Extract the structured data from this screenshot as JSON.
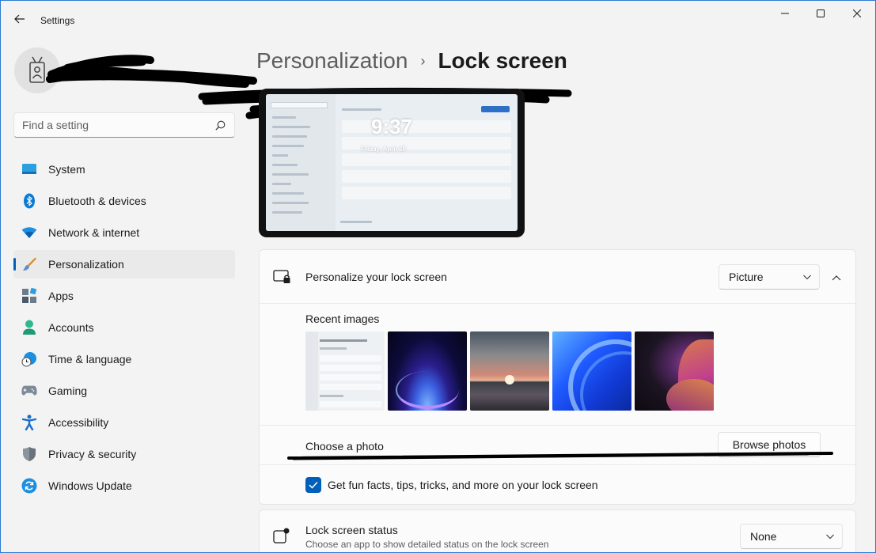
{
  "window": {
    "app_title": "Settings",
    "back_icon": "arrow-left-icon",
    "minimize_icon": "minimize-icon",
    "maximize_icon": "maximize-icon",
    "close_icon": "close-icon"
  },
  "profile": {
    "avatar_icon": "id-badge-icon"
  },
  "search": {
    "placeholder": "Find a setting",
    "value": "",
    "icon": "search-icon"
  },
  "sidebar": {
    "items": [
      {
        "label": "System",
        "icon": "system-icon",
        "active": false
      },
      {
        "label": "Bluetooth & devices",
        "icon": "bluetooth-icon",
        "active": false
      },
      {
        "label": "Network & internet",
        "icon": "wifi-icon",
        "active": false
      },
      {
        "label": "Personalization",
        "icon": "paintbrush-icon",
        "active": true
      },
      {
        "label": "Apps",
        "icon": "apps-icon",
        "active": false
      },
      {
        "label": "Accounts",
        "icon": "person-icon",
        "active": false
      },
      {
        "label": "Time & language",
        "icon": "globe-clock-icon",
        "active": false
      },
      {
        "label": "Gaming",
        "icon": "gamepad-icon",
        "active": false
      },
      {
        "label": "Accessibility",
        "icon": "accessibility-icon",
        "active": false
      },
      {
        "label": "Privacy & security",
        "icon": "shield-icon",
        "active": false
      },
      {
        "label": "Windows Update",
        "icon": "refresh-icon",
        "active": false
      }
    ]
  },
  "header": {
    "parent": "Personalization",
    "separator": "›",
    "current": "Lock screen"
  },
  "preview": {
    "time": "9:37",
    "date": "Friday, April 28"
  },
  "lock_screen_card": {
    "title": "Personalize your lock screen",
    "icon": "lock-screen-icon",
    "dropdown_value": "Picture",
    "expand_icon": "chevron-up-icon",
    "recent_images_label": "Recent images",
    "recent_images": [
      {
        "name": "Bluetooth & devices screenshot",
        "thumb": "screenshot-thumbnail"
      },
      {
        "name": "Windows bloom blue",
        "thumb": "bloom-blue-thumbnail"
      },
      {
        "name": "Sunset lake",
        "thumb": "sunset-thumbnail"
      },
      {
        "name": "Windows bloom light",
        "thumb": "bloom-light-thumbnail"
      },
      {
        "name": "Dark ribbon",
        "thumb": "ribbon-thumbnail"
      }
    ],
    "choose_photo_label": "Choose a photo",
    "browse_button": "Browse photos",
    "fun_facts_label": "Get fun facts, tips, tricks, and more on your lock screen",
    "fun_facts_checked": true
  },
  "status_card": {
    "title": "Lock screen status",
    "subtitle": "Choose an app to show detailed status on the lock screen",
    "icon": "status-icon",
    "dropdown_value": "None"
  },
  "colors": {
    "accent": "#005fb8",
    "background": "#f3f3f3",
    "card": "#fbfbfb",
    "window_border": "#2b7bd4"
  }
}
